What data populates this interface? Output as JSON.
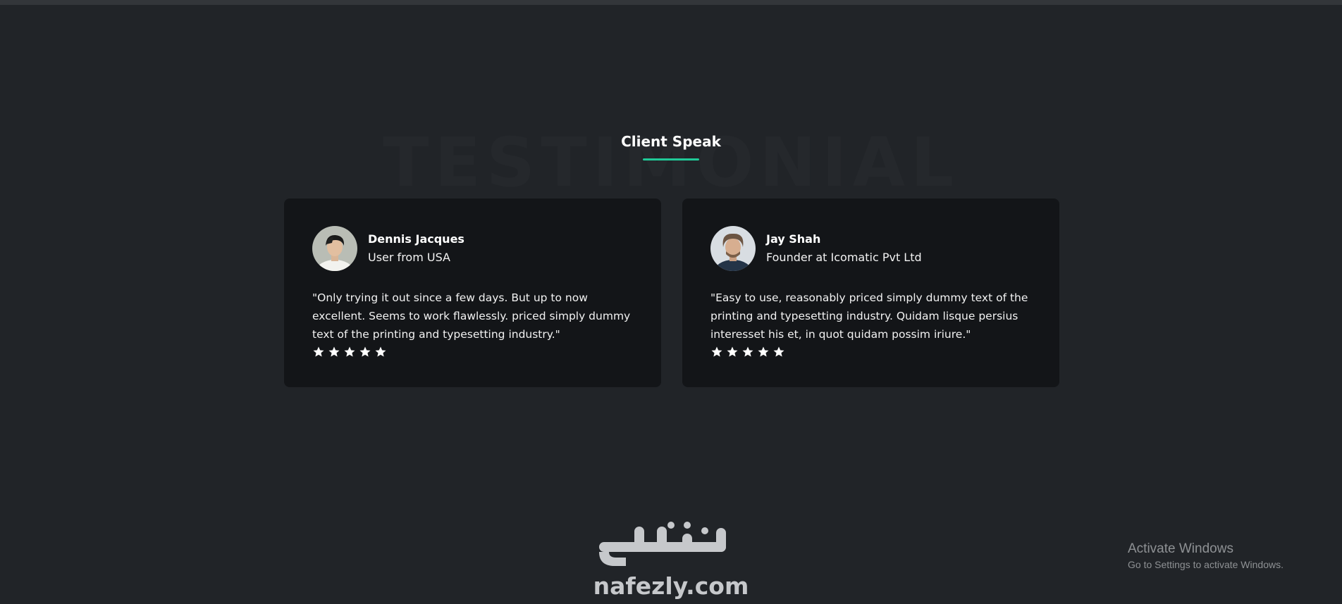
{
  "section": {
    "background_word": "TESTIMONIAL",
    "title": "Client Speak",
    "accent_color": "#20c997"
  },
  "testimonials": [
    {
      "name": "Dennis Jacques",
      "role": "User from USA",
      "quote": "\"Only trying it out since a few days. But up to now excellent. Seems to work flawlessly. priced simply dummy text of the printing and typesetting industry.\"",
      "rating": 5,
      "rating_max": 5,
      "avatar_icon": "avatar-photo"
    },
    {
      "name": "Jay Shah",
      "role": "Founder at Icomatic Pvt Ltd",
      "quote": "\"Easy to use, reasonably priced simply dummy text of the printing and typesetting industry. Quidam lisque persius interesset his et, in quot quidam possim iriure.\"",
      "rating": 5,
      "rating_max": 5,
      "avatar_icon": "avatar-photo"
    }
  ],
  "watermark": {
    "arabic": "نفذلي",
    "latin": "nafezly.com"
  },
  "windows_notice": {
    "title": "Activate Windows",
    "subtitle": "Go to Settings to activate Windows."
  }
}
